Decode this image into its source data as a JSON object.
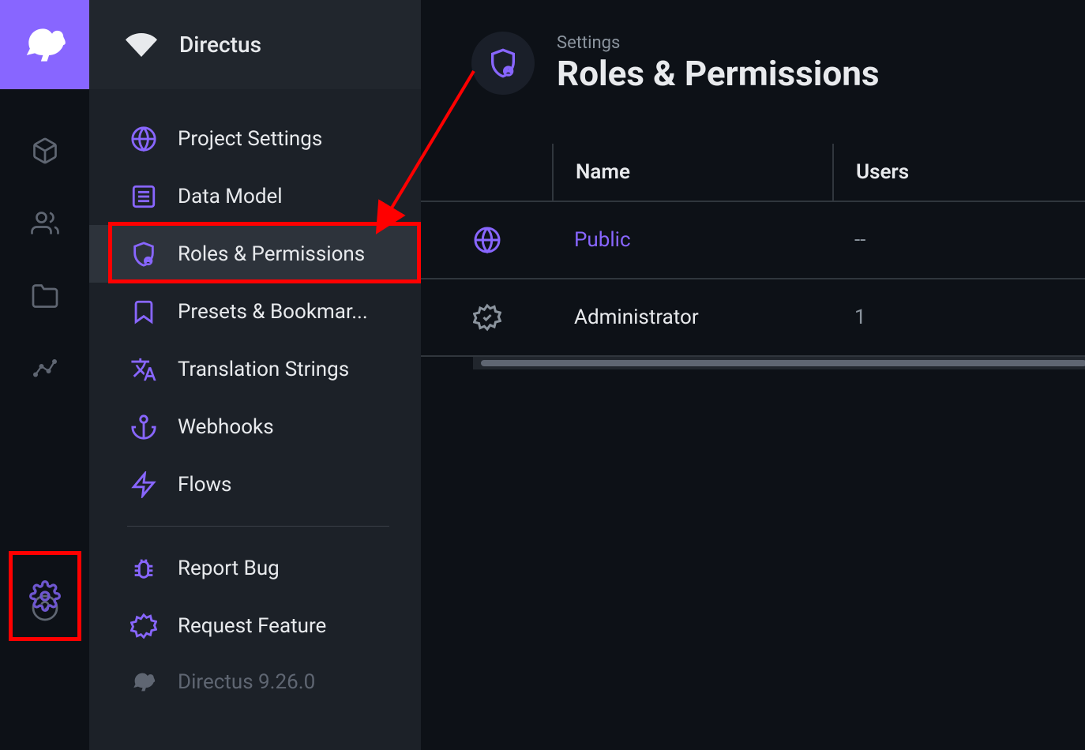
{
  "app_name": "Directus",
  "version": "Directus 9.26.0",
  "nav_items": [
    {
      "icon": "globe",
      "label": "Project Settings"
    },
    {
      "icon": "list",
      "label": "Data Model"
    },
    {
      "icon": "shield-user",
      "label": "Roles & Permissions"
    },
    {
      "icon": "bookmark",
      "label": "Presets & Bookmar..."
    },
    {
      "icon": "translate",
      "label": "Translation Strings"
    },
    {
      "icon": "anchor",
      "label": "Webhooks"
    },
    {
      "icon": "bolt",
      "label": "Flows"
    }
  ],
  "nav_secondary": [
    {
      "icon": "bug",
      "label": "Report Bug"
    },
    {
      "icon": "verified",
      "label": "Request Feature"
    }
  ],
  "breadcrumb": "Settings",
  "page_title": "Roles & Permissions",
  "table": {
    "columns": [
      "Name",
      "Users"
    ],
    "rows": [
      {
        "icon": "globe",
        "name": "Public",
        "users": "--",
        "accent": true
      },
      {
        "icon": "verified",
        "name": "Administrator",
        "users": "1",
        "accent": false
      }
    ]
  }
}
